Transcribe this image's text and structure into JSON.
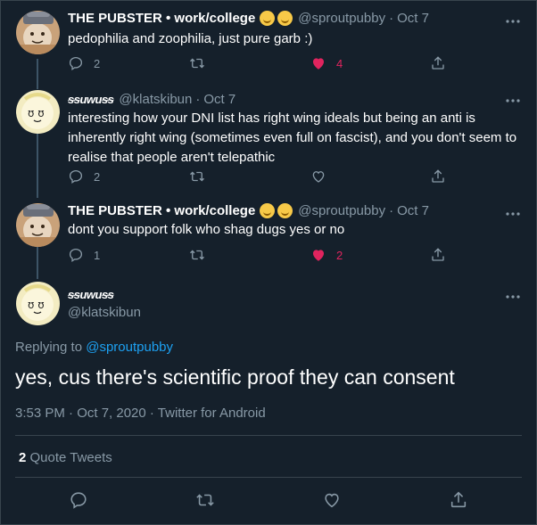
{
  "tweets": [
    {
      "name": "THE PUBSTER • work/college",
      "handle": "@sproutpubby",
      "date": "Oct 7",
      "text": "pedophilia and zoophilia, just pure garb :)",
      "replies": "2",
      "likes": "4",
      "liked": true
    },
    {
      "name": "ᵴᵴuwuᵴᵴ",
      "handle": "@klatskibun",
      "date": "Oct 7",
      "text": "interesting how your DNI list has right wing ideals but being an anti is inherently right wing (sometimes even full on fascist), and you don't seem to realise that people aren't telepathic",
      "replies": "2",
      "likes": "",
      "liked": false
    },
    {
      "name": "THE PUBSTER • work/college",
      "handle": "@sproutpubby",
      "date": "Oct 7",
      "text": "dont you support folk who shag dugs yes or no",
      "replies": "1",
      "likes": "2",
      "liked": true
    }
  ],
  "focus": {
    "name": "ᵴᵴuwuᵴᵴ",
    "handle": "@klatskibun",
    "replying_prefix": "Replying to ",
    "replying_handle": "@sproutpubby",
    "text": "yes, cus there's scientific proof they can consent",
    "meta": "3:53 PM · Oct 7, 2020 · Twitter for Android",
    "quote_count": "2",
    "quote_label": " Quote Tweets"
  },
  "separator": "·",
  "icons": {
    "reply": "reply-icon",
    "retweet": "retweet-icon",
    "like": "heart-icon",
    "share": "share-icon",
    "more": "more-icon"
  },
  "colors": {
    "background": "#15202b",
    "secondary_text": "#8899a6",
    "link": "#1da1f2",
    "like": "#e0245e",
    "border": "#38444d"
  }
}
